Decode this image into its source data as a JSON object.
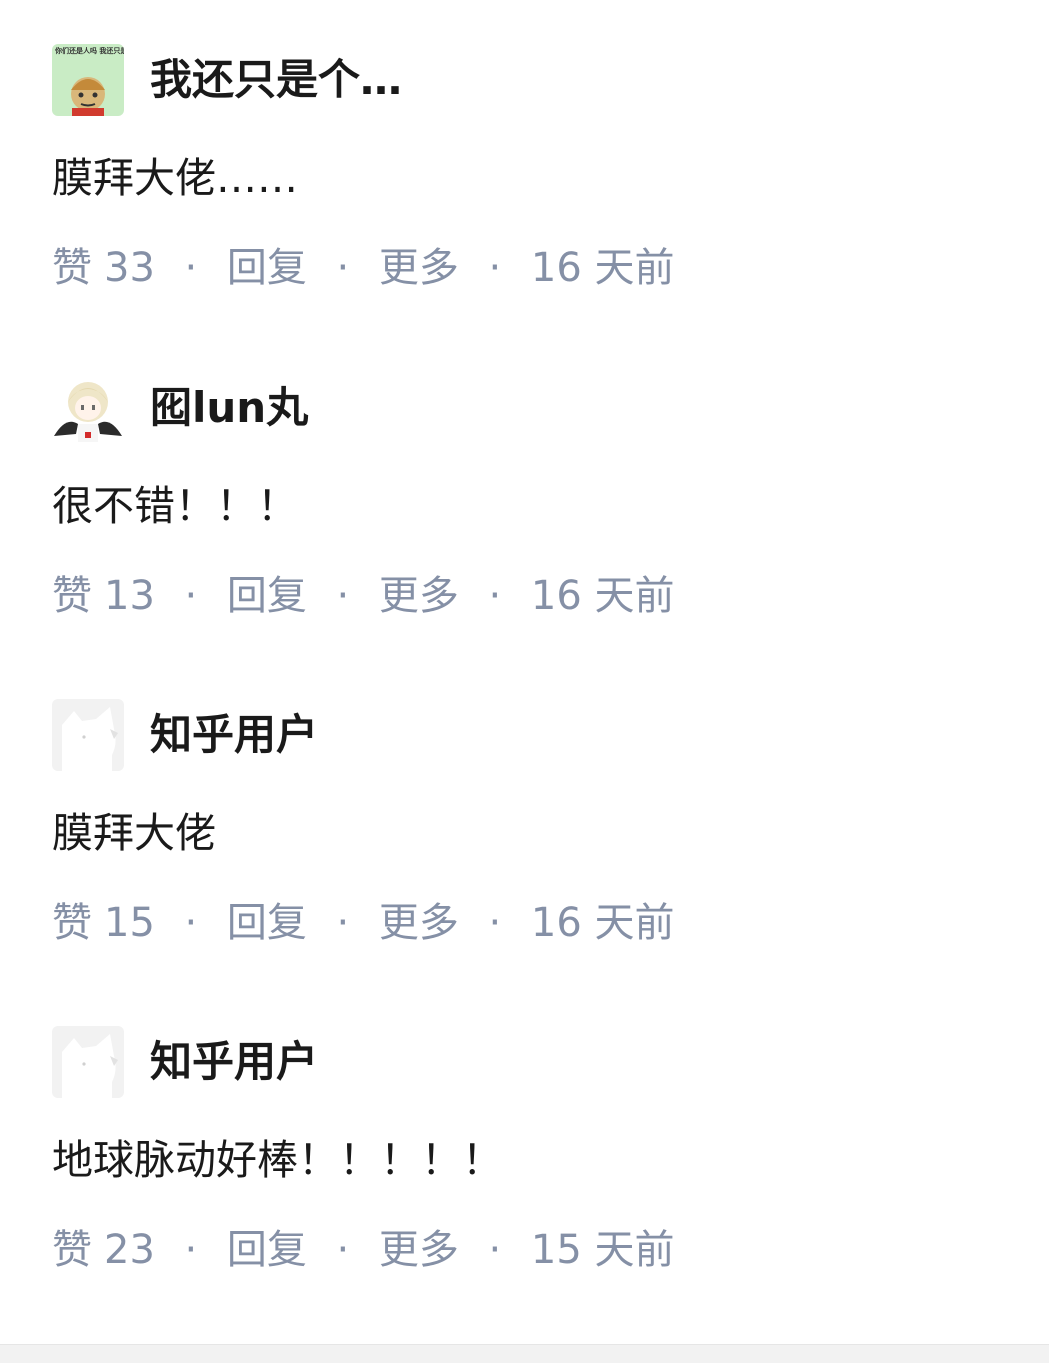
{
  "comments": [
    {
      "author": "我还只是个…",
      "avatar": "meme-face-avatar",
      "avatar_caption": "你们还是人吗 我还只是个孩子 啊",
      "content": "膜拜大佬……",
      "like_label": "赞",
      "like_count": "33",
      "reply_label": "回复",
      "more_label": "更多",
      "time": "16 天前"
    },
    {
      "author": "囮lun丸",
      "avatar": "anime-angel-avatar",
      "content": "很不错！！！",
      "like_label": "赞",
      "like_count": "13",
      "reply_label": "回复",
      "more_label": "更多",
      "time": "16 天前"
    },
    {
      "author": "知乎用户",
      "avatar": "default-user-avatar",
      "content": "膜拜大佬",
      "like_label": "赞",
      "like_count": "15",
      "reply_label": "回复",
      "more_label": "更多",
      "time": "16 天前"
    },
    {
      "author": "知乎用户",
      "avatar": "default-user-avatar",
      "content": "地球脉动好棒！！！！！",
      "like_label": "赞",
      "like_count": "23",
      "reply_label": "回复",
      "more_label": "更多",
      "time": "15 天前"
    }
  ],
  "separator": "·",
  "colors": {
    "text_primary": "#1a1a1a",
    "text_meta": "#8590a6",
    "background": "#ffffff"
  }
}
